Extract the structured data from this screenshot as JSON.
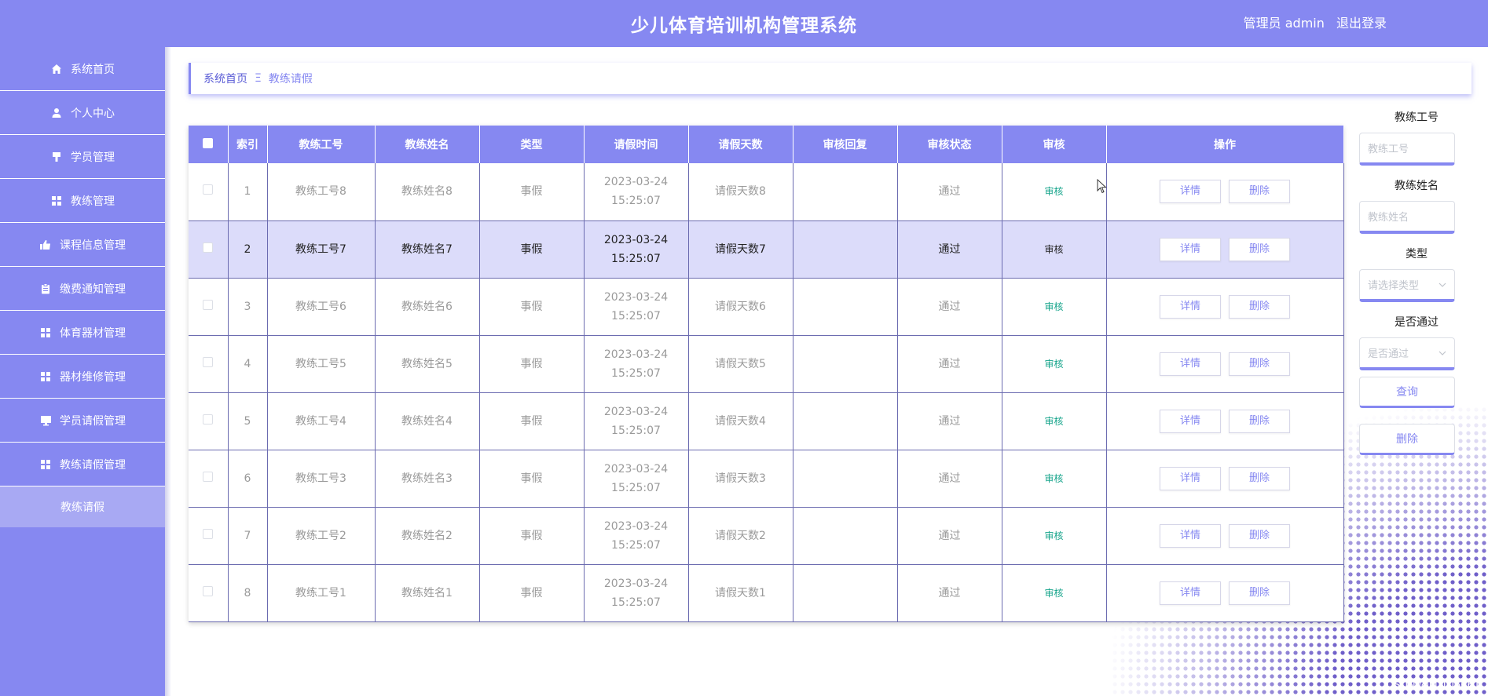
{
  "header": {
    "title": "少儿体育培训机构管理系统",
    "user_label": "管理员 admin",
    "logout_label": "退出登录"
  },
  "sidebar": {
    "items": [
      {
        "label": "系统首页",
        "icon": "home-icon"
      },
      {
        "label": "个人中心",
        "icon": "user-icon"
      },
      {
        "label": "学员管理",
        "icon": "brush-icon"
      },
      {
        "label": "教练管理",
        "icon": "grid-icon"
      },
      {
        "label": "课程信息管理",
        "icon": "thumb-icon"
      },
      {
        "label": "缴费通知管理",
        "icon": "clipboard-icon"
      },
      {
        "label": "体育器材管理",
        "icon": "grid-icon"
      },
      {
        "label": "器材维修管理",
        "icon": "grid-icon"
      },
      {
        "label": "学员请假管理",
        "icon": "monitor-icon"
      },
      {
        "label": "教练请假管理",
        "icon": "grid-icon"
      }
    ],
    "sub_item": "教练请假"
  },
  "breadcrumb": {
    "home": "系统首页",
    "separator": "Ξ",
    "current": "教练请假"
  },
  "table": {
    "headers": [
      "索引",
      "教练工号",
      "教练姓名",
      "类型",
      "请假时间",
      "请假天数",
      "审核回复",
      "审核状态",
      "审核",
      "操作"
    ],
    "rows": [
      {
        "index": "1",
        "coach_no": "教练工号8",
        "coach_name": "教练姓名8",
        "type": "事假",
        "time": "2023-03-24 15:25:07",
        "days": "请假天数8",
        "reply": "",
        "status": "通过",
        "audit": "审核"
      },
      {
        "index": "2",
        "coach_no": "教练工号7",
        "coach_name": "教练姓名7",
        "type": "事假",
        "time": "2023-03-24 15:25:07",
        "days": "请假天数7",
        "reply": "",
        "status": "通过",
        "audit": "审核"
      },
      {
        "index": "3",
        "coach_no": "教练工号6",
        "coach_name": "教练姓名6",
        "type": "事假",
        "time": "2023-03-24 15:25:07",
        "days": "请假天数6",
        "reply": "",
        "status": "通过",
        "audit": "审核"
      },
      {
        "index": "4",
        "coach_no": "教练工号5",
        "coach_name": "教练姓名5",
        "type": "事假",
        "time": "2023-03-24 15:25:07",
        "days": "请假天数5",
        "reply": "",
        "status": "通过",
        "audit": "审核"
      },
      {
        "index": "5",
        "coach_no": "教练工号4",
        "coach_name": "教练姓名4",
        "type": "事假",
        "time": "2023-03-24 15:25:07",
        "days": "请假天数4",
        "reply": "",
        "status": "通过",
        "audit": "审核"
      },
      {
        "index": "6",
        "coach_no": "教练工号3",
        "coach_name": "教练姓名3",
        "type": "事假",
        "time": "2023-03-24 15:25:07",
        "days": "请假天数3",
        "reply": "",
        "status": "通过",
        "audit": "审核"
      },
      {
        "index": "7",
        "coach_no": "教练工号2",
        "coach_name": "教练姓名2",
        "type": "事假",
        "time": "2023-03-24 15:25:07",
        "days": "请假天数2",
        "reply": "",
        "status": "通过",
        "audit": "审核"
      },
      {
        "index": "8",
        "coach_no": "教练工号1",
        "coach_name": "教练姓名1",
        "type": "事假",
        "time": "2023-03-24 15:25:07",
        "days": "请假天数1",
        "reply": "",
        "status": "通过",
        "audit": "审核"
      }
    ],
    "detail_label": "详情",
    "delete_label": "删除"
  },
  "filter": {
    "coach_no_label": "教练工号",
    "coach_no_placeholder": "教练工号",
    "coach_name_label": "教练姓名",
    "coach_name_placeholder": "教练姓名",
    "type_label": "类型",
    "type_placeholder": "请选择类型",
    "passed_label": "是否通过",
    "passed_placeholder": "是否通过",
    "query_label": "查询",
    "delete_label": "删除"
  },
  "watermark": "CSDN @liu106661",
  "colors": {
    "primary": "#8688f1",
    "highlight_row": "#dcdcfa",
    "audit_text": "#18a58c"
  }
}
